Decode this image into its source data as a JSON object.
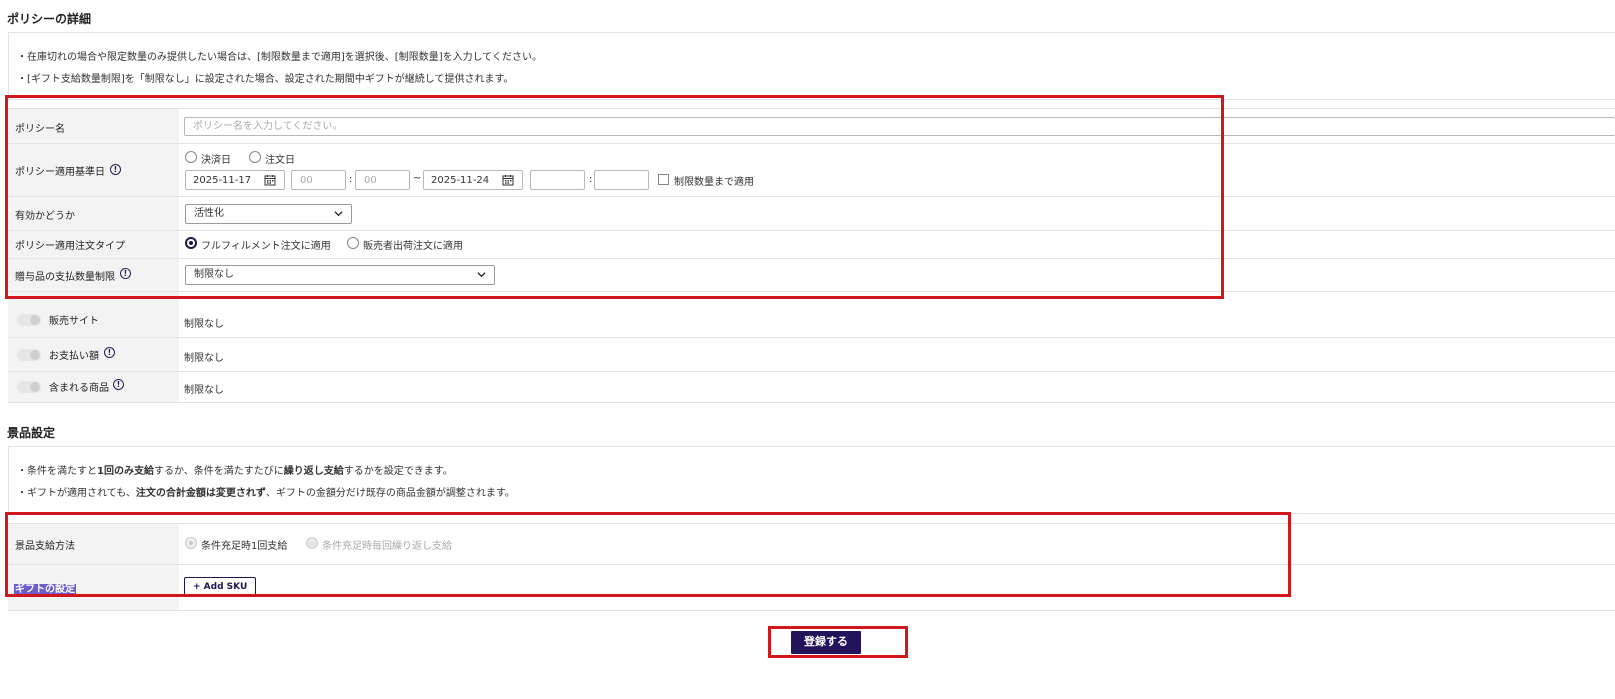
{
  "policy_section": {
    "title": "ポリシーの詳細",
    "notes": [
      "・在庫切れの場合や限定数量のみ提供したい場合は、[制限数量まで適用]を選択後、[制限数量]を入力してください。",
      "・[ギフト支給数量制限]を「制限なし」に設定された場合、設定された期間中ギフトが継続して提供されます。"
    ],
    "policy_name": {
      "label": "ポリシー名",
      "placeholder": "ポリシー名を入力してください。"
    },
    "apply_date": {
      "label": "ポリシー適用基準日",
      "radio_payment": "決済日",
      "radio_order": "注文日",
      "start_date": "2025-11-17",
      "start_hour_placeholder": "00",
      "start_min_placeholder": "00",
      "tilde": "~",
      "colon": ":",
      "end_date": "2025-11-24",
      "end_hour": "",
      "end_min": "",
      "limit_checkbox_label": "制限数量まで適用"
    },
    "validity": {
      "label": "有効かどうか",
      "value": "活性化"
    },
    "order_type": {
      "label": "ポリシー適用注文タイプ",
      "option_fulfillment": "フルフィルメント注文に適用",
      "option_seller": "販売者出荷注文に適用",
      "selected": "フルフィルメント注文に適用"
    },
    "gift_limit": {
      "label": "贈与品の支払数量制限",
      "value": "制限なし"
    },
    "conditions": [
      {
        "label": "販売サイト",
        "value": "制限なし",
        "info": false
      },
      {
        "label": "お支払い額",
        "value": "制限なし",
        "info": true
      },
      {
        "label": "含まれる商品",
        "value": "制限なし",
        "info": true
      }
    ]
  },
  "prize_section": {
    "title": "景品設定",
    "note1_parts": [
      "・条件を満たすと",
      "1回のみ支給",
      "するか、条件を満たすたびに",
      "繰り返し支給",
      "するかを設定できます。"
    ],
    "note2_parts": [
      "・ギフトが適用されても、",
      "注文の合計金額は変更されず",
      "、ギフトの金額分だけ既存の商品金額が調整されます。"
    ],
    "method": {
      "label": "景品支給方法",
      "option_once": "条件充足時1回支給",
      "option_repeat": "条件充足時毎回繰り返し支給"
    },
    "gift_setting": {
      "label": "ギフトの設定",
      "add_sku": "+ Add SKU"
    }
  },
  "submit_label": "登録する",
  "colors": {
    "primary": "#22135a",
    "highlight_box": "#d0171b",
    "label_bg": "#f3f3f3"
  },
  "icons": [
    "info-icon",
    "calendar-icon",
    "chevron-down-icon",
    "toggle-switch"
  ]
}
